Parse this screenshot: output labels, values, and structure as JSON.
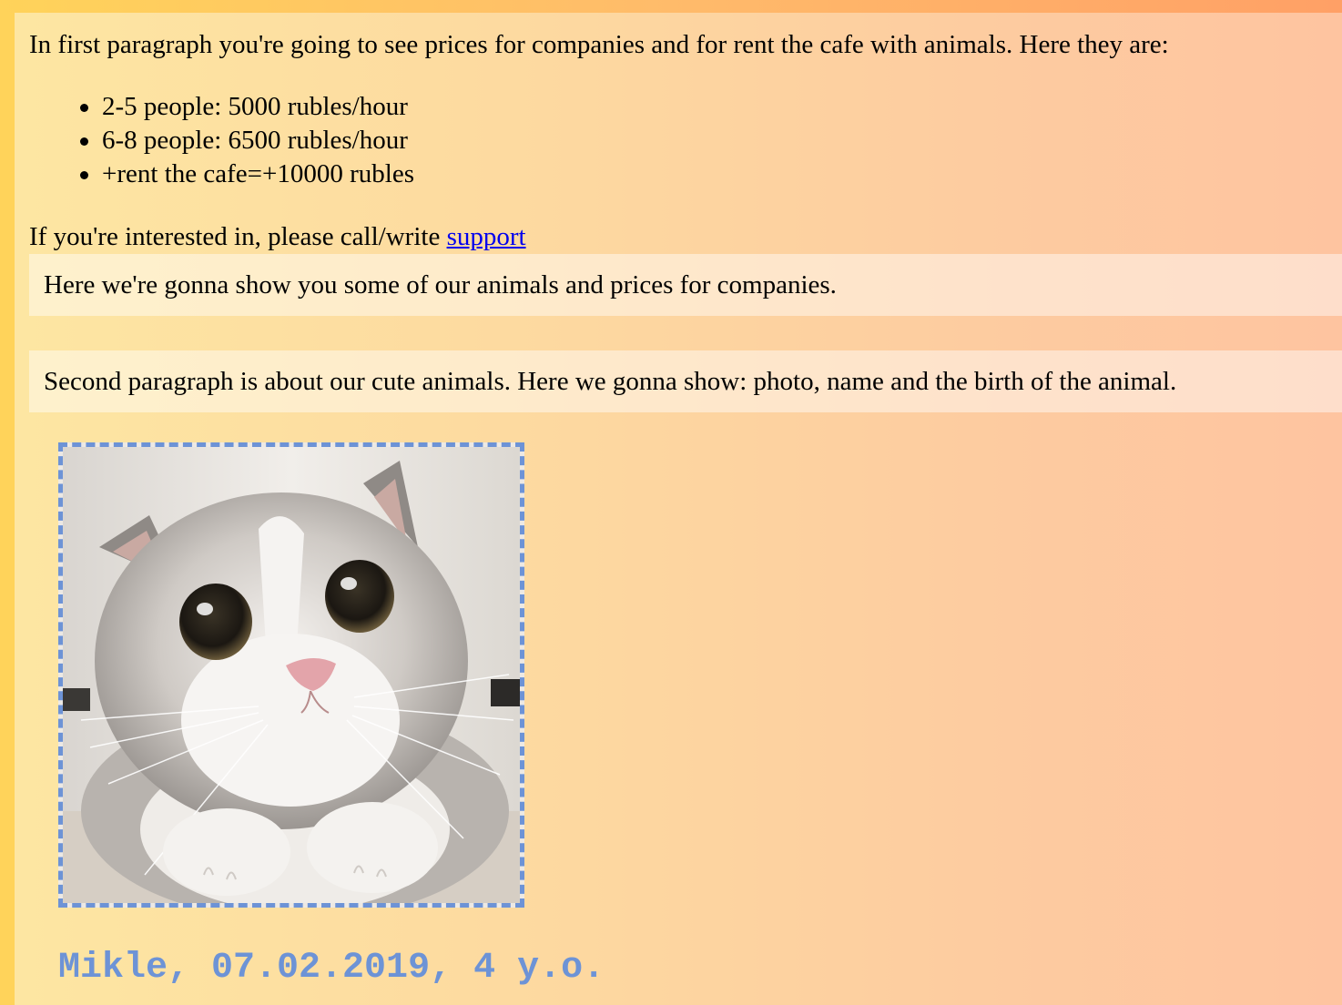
{
  "intro": {
    "text": "In first paragraph you're going to see prices for companies and for rent the cafe with animals. Here they are:"
  },
  "prices": [
    "2-5 people: 5000 rubles/hour",
    "6-8 people: 6500 rubles/hour",
    "+rent the cafe=+10000 rubles"
  ],
  "contact": {
    "text": "If you're interested in, please call/write ",
    "link_label": "support"
  },
  "banners": {
    "first": "Here we're gonna show you some of our animals and prices for companies.",
    "second": "Second paragraph is about our cute animals. Here we gonna show: photo, name and the birth of the animal."
  },
  "animal": {
    "photo_alt": "cat",
    "caption": "Mikle, 07.02.2019, 4 y.o."
  },
  "colors": {
    "outer_background": "#ffd35a",
    "accent_blue": "#6d93d6",
    "link": "#0000ee"
  }
}
